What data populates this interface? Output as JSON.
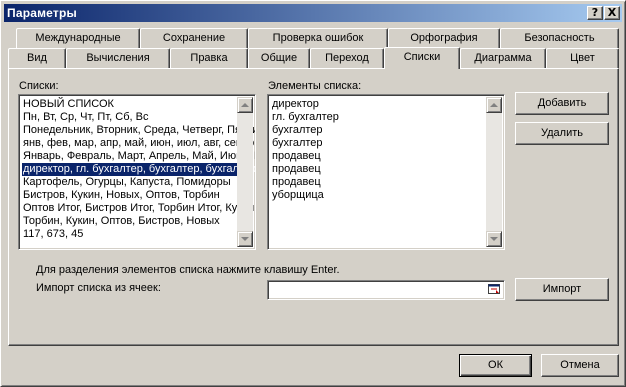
{
  "window": {
    "title": "Параметры",
    "help_glyph": "?",
    "close_glyph": "X"
  },
  "tabs_row1": [
    {
      "label": "Международные"
    },
    {
      "label": "Сохранение"
    },
    {
      "label": "Проверка ошибок"
    },
    {
      "label": "Орфография"
    },
    {
      "label": "Безопасность"
    }
  ],
  "tabs_row2": [
    {
      "label": "Вид"
    },
    {
      "label": "Вычисления"
    },
    {
      "label": "Правка"
    },
    {
      "label": "Общие"
    },
    {
      "label": "Переход"
    },
    {
      "label": "Списки",
      "active": true
    },
    {
      "label": "Диаграмма"
    },
    {
      "label": "Цвет"
    }
  ],
  "lists": {
    "label": "Списки:",
    "selected_index": 5,
    "items": [
      "НОВЫЙ СПИСОК",
      "Пн, Вт, Ср, Чт, Пт, Сб, Вс",
      "Понедельник, Вторник, Среда, Четверг, Пятница, Суббота, Воскресенье",
      "янв, фев, мар, апр, май, июн, июл, авг, сен, окт, ноя, дек",
      "Январь, Февраль, Март, Апрель, Май, Июнь, Июль",
      "директор, гл. бухгалтер, бухгалтер, бухгалтер, продавец",
      "Картофель, Огурцы, Капуста, Помидоры",
      "Бистров, Кукин, Новых, Оптов, Торбин",
      "Оптов Итог, Бистров Итог, Торбин Итог, Кукин Итог",
      "Торбин, Кукин, Оптов, Бистров, Новых",
      "117, 673, 45"
    ]
  },
  "entries": {
    "label": "Элементы списка:",
    "items": [
      "директор",
      "гл. бухгалтер",
      "бухгалтер",
      "бухгалтер",
      "продавец",
      "продавец",
      "продавец",
      "уборщица"
    ]
  },
  "buttons": {
    "add": "Добавить",
    "delete": "Удалить",
    "import": "Импорт",
    "ok": "ОК",
    "cancel": "Отмена"
  },
  "hint": "Для разделения элементов списка нажмите клавишу Enter.",
  "import_label": "Импорт списка из ячеек:",
  "import_value": "",
  "icons": {
    "collapse": "range-select-icon"
  }
}
